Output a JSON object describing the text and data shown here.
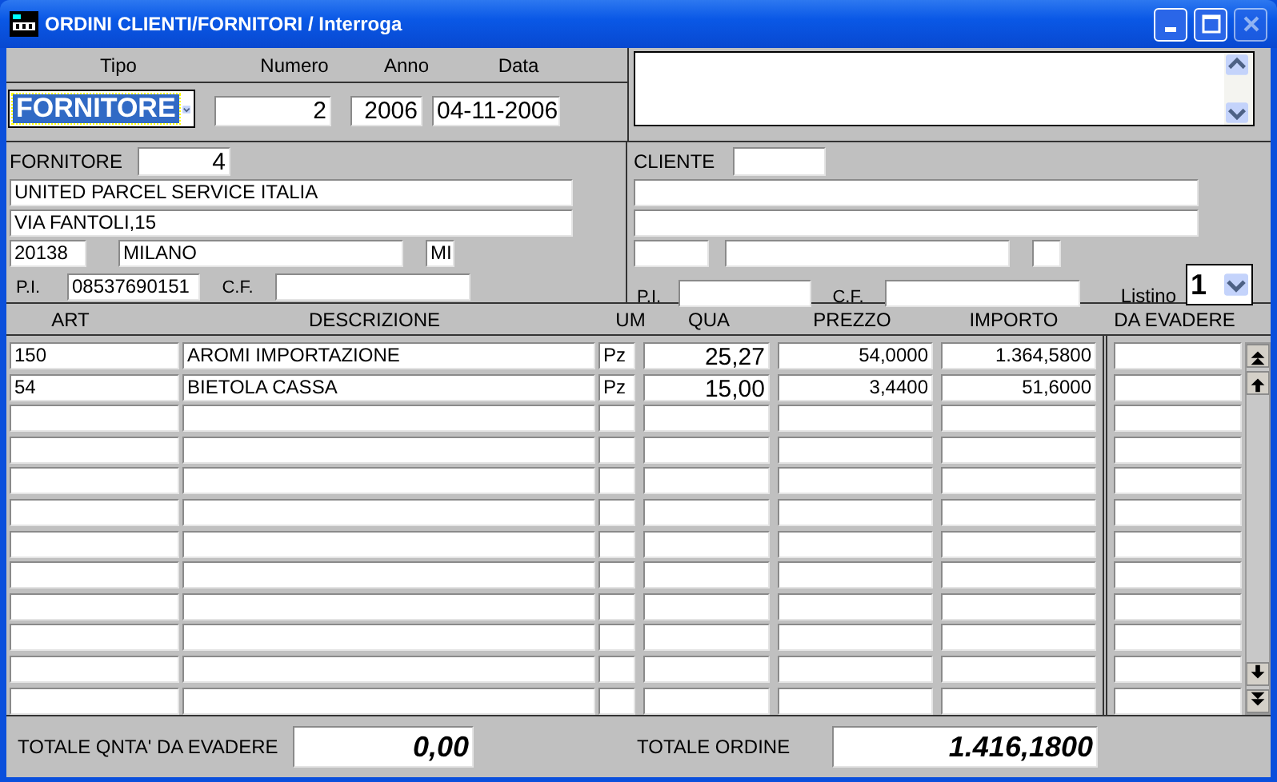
{
  "window": {
    "title": "ORDINI CLIENTI/FORNITORI / Interroga"
  },
  "header": {
    "labels": [
      "Tipo",
      "Numero",
      "Anno",
      "Data"
    ],
    "tipo": "FORNITORE",
    "numero": "2",
    "anno": "2006",
    "data": "04-11-2006"
  },
  "fornitore": {
    "label": "FORNITORE",
    "code": "4",
    "name": "UNITED PARCEL SERVICE ITALIA",
    "address": "VIA FANTOLI,15",
    "cap": "20138",
    "city": "MILANO",
    "province": "MI",
    "pi_label": "P.I.",
    "pi": "08537690151",
    "cf_label": "C.F."
  },
  "cliente": {
    "label": "CLIENTE",
    "pi_label": "P.I.",
    "cf_label": "C.F.",
    "listino_label": "Listino",
    "listino": "1"
  },
  "table": {
    "columns": [
      "ART",
      "DESCRIZIONE",
      "UM",
      "QUA",
      "PREZZO",
      "IMPORTO",
      "DA EVADERE"
    ],
    "rows": [
      {
        "art": "150",
        "descrizione": "AROMI IMPORTAZIONE",
        "um": "Pz",
        "qua": "25,27",
        "prezzo": "54,0000",
        "importo": "1.364,5800"
      },
      {
        "art": "54",
        "descrizione": "BIETOLA CASSA",
        "um": "Pz",
        "qua": "15,00",
        "prezzo": "3,4400",
        "importo": "51,6000"
      }
    ]
  },
  "totals": [
    {
      "label": "TOTALE QNTA' DA EVADERE",
      "value": "0,00"
    },
    {
      "label": "TOTALE ORDINE",
      "value": "1.416,1800"
    }
  ]
}
